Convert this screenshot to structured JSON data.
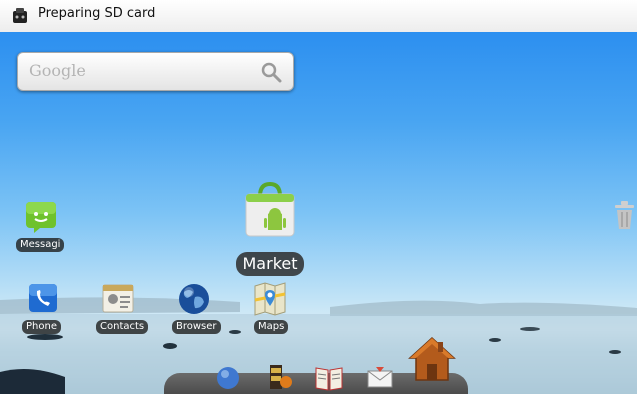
{
  "status_bar": {
    "notification": "Preparing SD card",
    "icon": "sd-card-icon"
  },
  "search": {
    "placeholder": "Google",
    "icon": "search-icon"
  },
  "apps": {
    "messaging": {
      "label": "Messagi",
      "icon": "messaging-icon"
    },
    "market": {
      "label": "Market",
      "icon": "market-bag-icon"
    },
    "phone": {
      "label": "Phone",
      "icon": "phone-icon"
    },
    "contacts": {
      "label": "Contacts",
      "icon": "contacts-icon"
    },
    "browser": {
      "label": "Browser",
      "icon": "browser-globe-icon"
    },
    "maps": {
      "label": "Maps",
      "icon": "maps-icon"
    }
  },
  "trash": {
    "icon": "trash-icon"
  },
  "dock": {
    "items": [
      {
        "icon": "globe-icon"
      },
      {
        "icon": "media-icon"
      },
      {
        "icon": "book-icon"
      },
      {
        "icon": "email-icon"
      },
      {
        "icon": "home-icon"
      }
    ]
  },
  "colors": {
    "sky_top": "#2c8ff0",
    "sky_horizon": "#dbeef6",
    "label_bg": "#1e1e1e"
  }
}
